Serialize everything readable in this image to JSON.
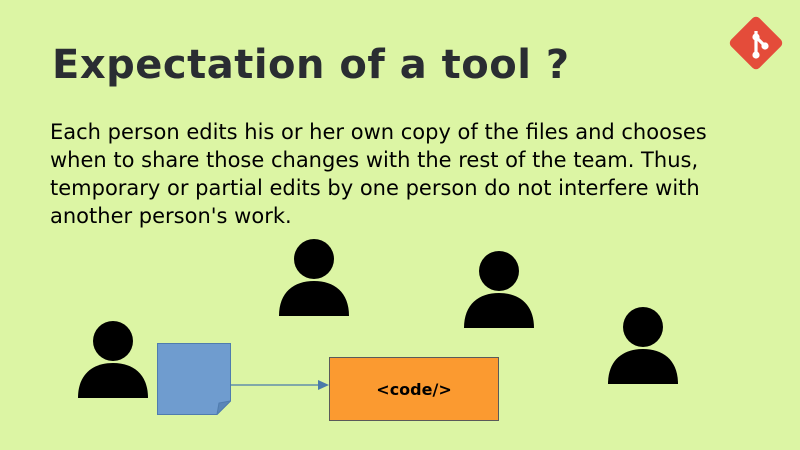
{
  "slide": {
    "title": "Expectation of a tool ?",
    "body": "Each person edits his or her own copy of the files and chooses when to share those changes with the rest of the team. Thus, temporary or partial edits by one person do not interfere with another person's work.",
    "code_label": "<code/>"
  },
  "icons": {
    "logo": "git-logo-icon",
    "person": "person-icon",
    "document": "document-icon",
    "arrow": "arrow-right-icon"
  },
  "colors": {
    "background": "#dcf5a4",
    "title": "#2a2d32",
    "git_logo": "#e44c3a",
    "document": "#6f9ccf",
    "code_box": "#fb9a30",
    "arrow": "#4a7aaa"
  }
}
